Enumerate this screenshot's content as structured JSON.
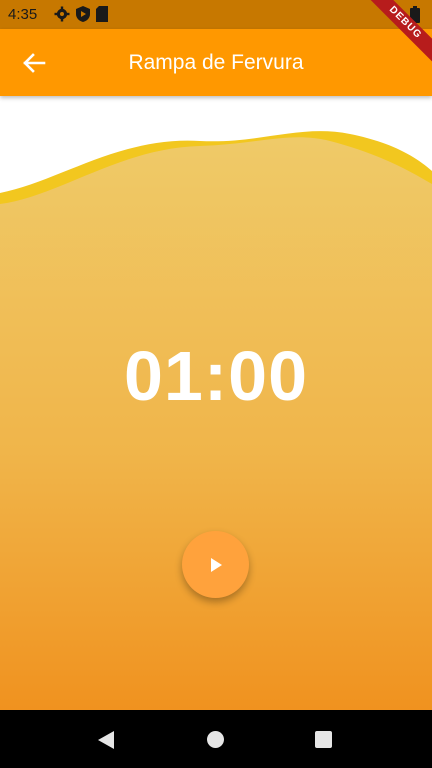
{
  "status_bar": {
    "time": "4:35",
    "icons": [
      "gear-icon",
      "shield-play-icon",
      "sd-card-icon",
      "wifi-icon",
      "battery-icon"
    ]
  },
  "debug_banner": "DEBUG",
  "app_bar": {
    "title": "Rampa de Fervura",
    "back_icon": "arrow-left-icon",
    "background": "#ff9800"
  },
  "timer": {
    "display": "01:00"
  },
  "play_button": {
    "icon": "play-icon",
    "color": "#ffa23c"
  },
  "nav_bar": {
    "buttons": [
      "back-triangle-icon",
      "home-circle-icon",
      "recents-square-icon"
    ]
  },
  "colors": {
    "gradient_top": "#efca68",
    "gradient_bottom": "#f0921f",
    "wave_back": "#f2c71f"
  }
}
